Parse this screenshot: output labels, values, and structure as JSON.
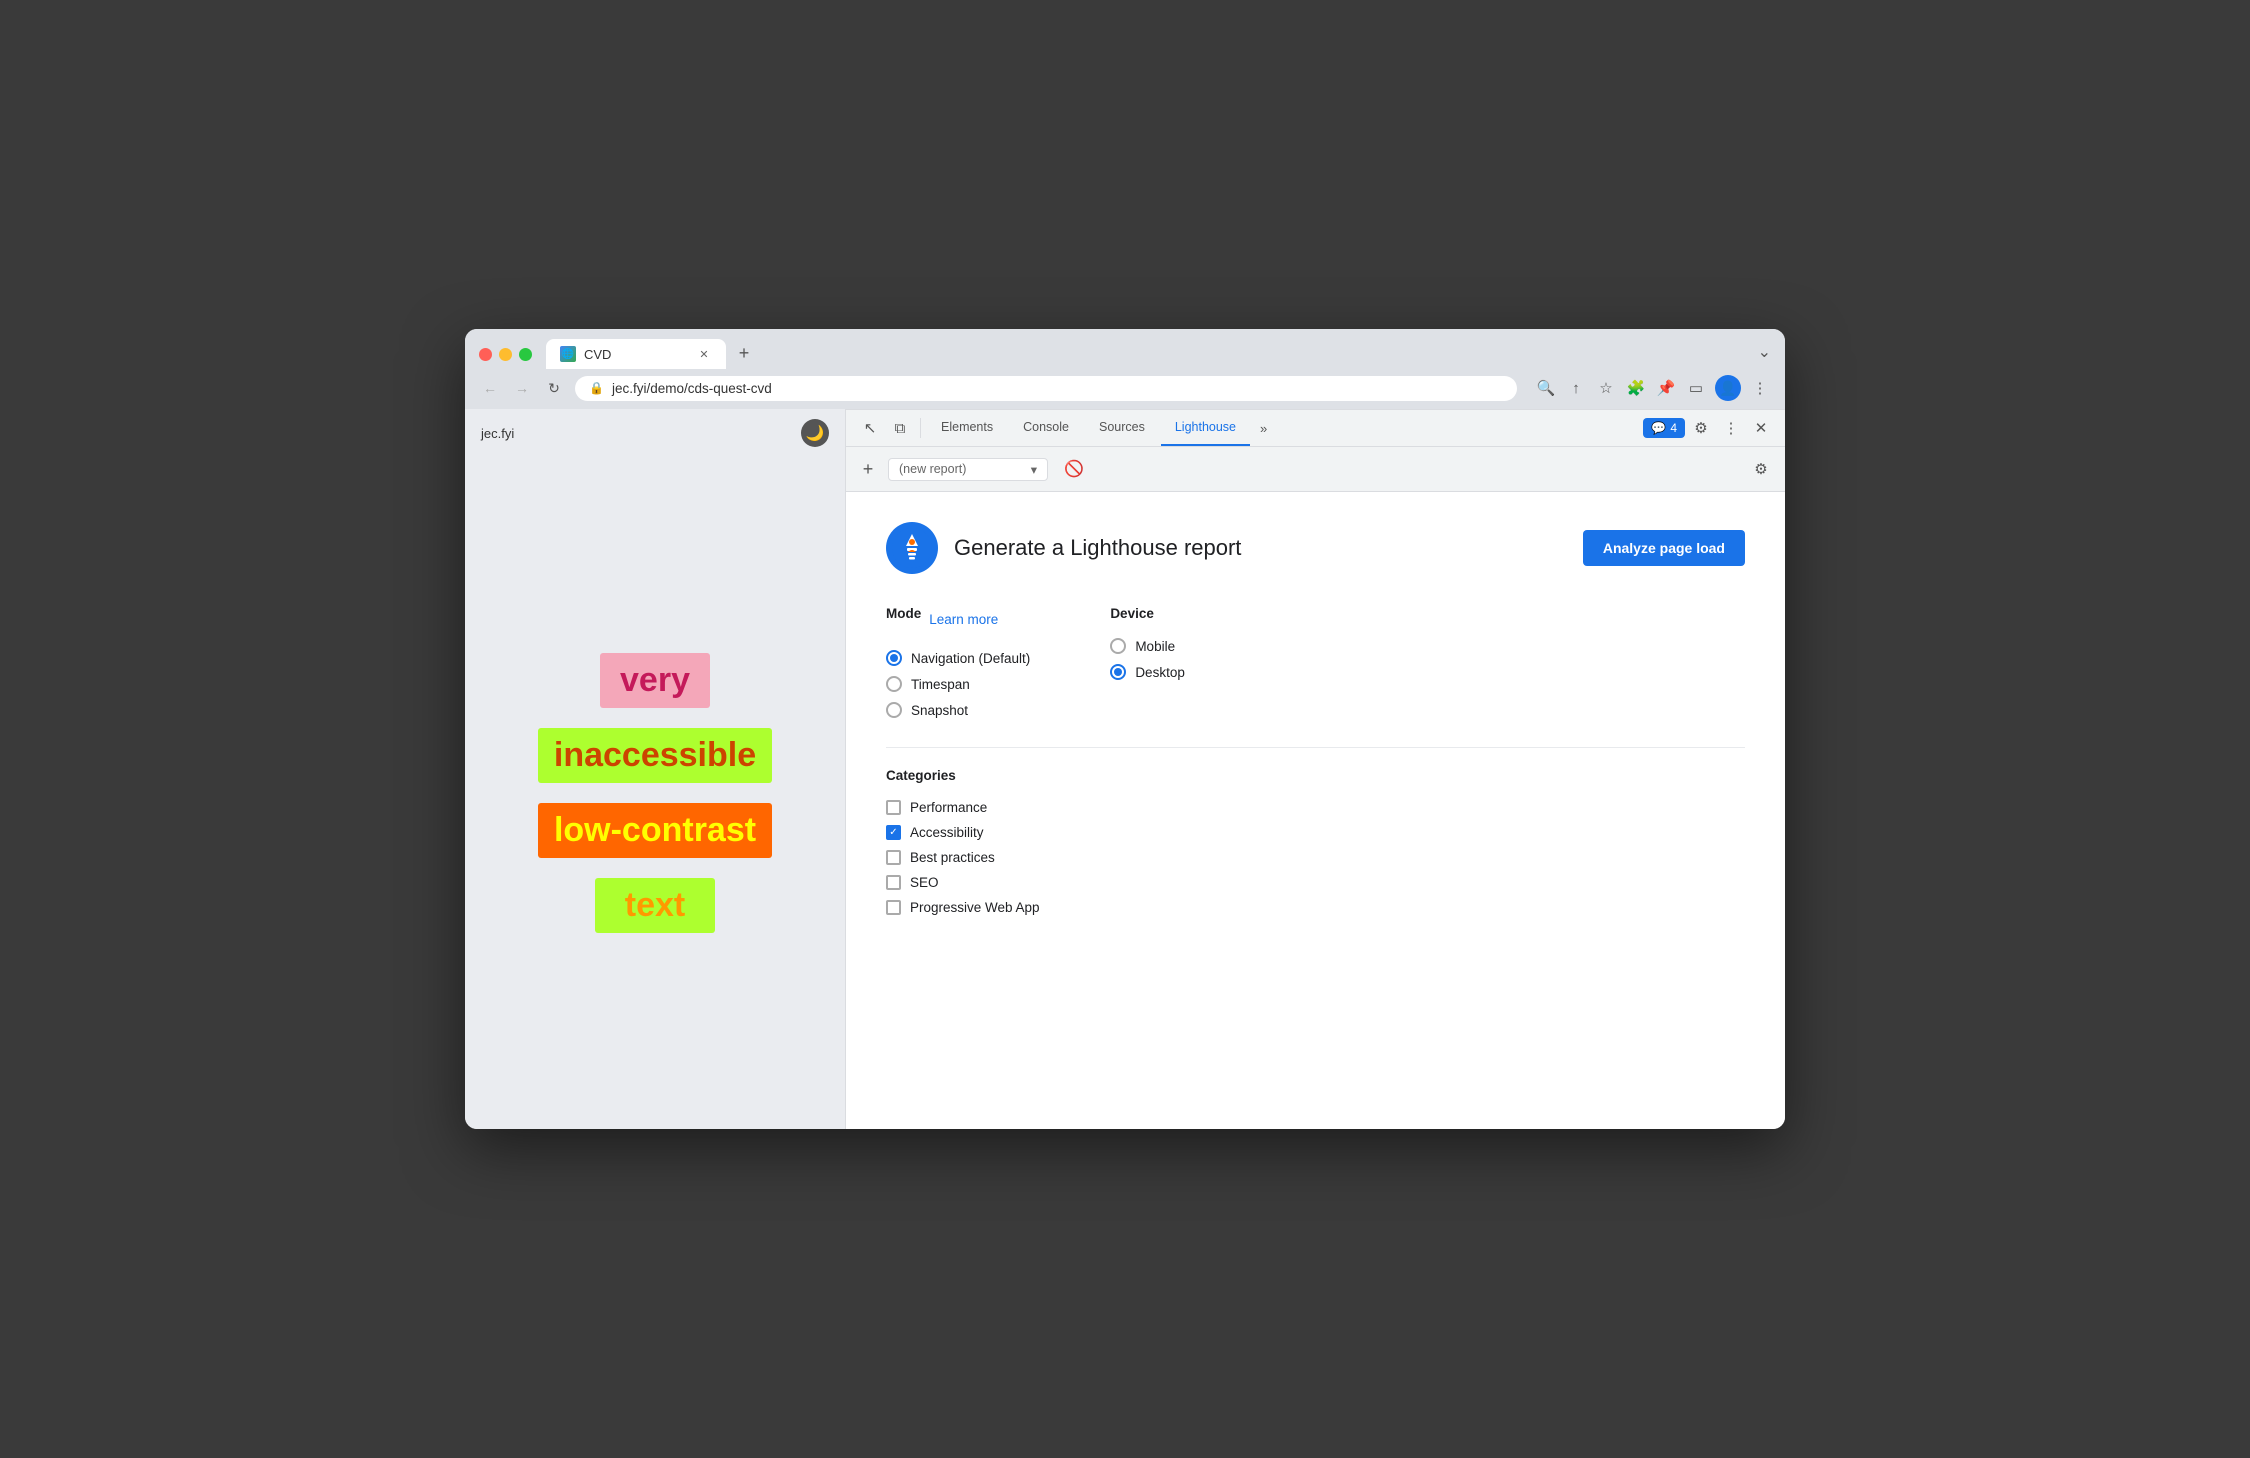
{
  "browser": {
    "traffic_lights": [
      "red",
      "yellow",
      "green"
    ],
    "tab": {
      "title": "CVD",
      "favicon_text": "🌐"
    },
    "new_tab_icon": "+",
    "window_dropdown_icon": "⌄",
    "address_bar": {
      "lock_icon": "🔒",
      "url": "jec.fyi/demo/cds-quest-cvd"
    },
    "nav": {
      "back": "←",
      "forward": "→",
      "refresh": "↻"
    }
  },
  "devtools": {
    "inspector_icon": "↖",
    "responsive_icon": "⧉",
    "tabs": [
      {
        "label": "Elements",
        "active": false
      },
      {
        "label": "Console",
        "active": false
      },
      {
        "label": "Sources",
        "active": false
      },
      {
        "label": "Lighthouse",
        "active": true
      }
    ],
    "more_icon": "»",
    "badge": {
      "icon": "💬",
      "count": "4"
    },
    "settings_icon": "⚙",
    "more_dots": "⋮",
    "close_icon": "✕"
  },
  "new_report_bar": {
    "add_icon": "+",
    "dropdown_label": "(new report)",
    "dropdown_icon": "▾",
    "no_icon": "🚫",
    "settings_icon": "⚙"
  },
  "webpage": {
    "site_label": "jec.fyi",
    "dark_mode_icon": "🌙",
    "words": [
      {
        "text": "very",
        "bg": "#f4a7b9",
        "color": "#d4145a",
        "padding": "8px 18px"
      },
      {
        "text": "inaccessible",
        "bg": "#adff2f",
        "color": "#e65c00",
        "padding": "8px 18px"
      },
      {
        "text": "low-contrast",
        "bg": "#ff6600",
        "color": "#ffff00",
        "padding": "8px 18px"
      },
      {
        "text": "text",
        "bg": "#adff2f",
        "color": "#ff9900",
        "padding": "8px 18px"
      }
    ]
  },
  "lighthouse": {
    "logo_alt": "Lighthouse logo",
    "title": "Generate a Lighthouse report",
    "analyze_btn": "Analyze page load",
    "mode_label": "Mode",
    "learn_more": "Learn more",
    "modes": [
      {
        "label": "Navigation (Default)",
        "selected": true
      },
      {
        "label": "Timespan",
        "selected": false
      },
      {
        "label": "Snapshot",
        "selected": false
      }
    ],
    "device_label": "Device",
    "devices": [
      {
        "label": "Mobile",
        "selected": false
      },
      {
        "label": "Desktop",
        "selected": true
      }
    ],
    "categories_label": "Categories",
    "categories": [
      {
        "label": "Performance",
        "checked": false
      },
      {
        "label": "Accessibility",
        "checked": true
      },
      {
        "label": "Best practices",
        "checked": false
      },
      {
        "label": "SEO",
        "checked": false
      },
      {
        "label": "Progressive Web App",
        "checked": false
      }
    ]
  }
}
